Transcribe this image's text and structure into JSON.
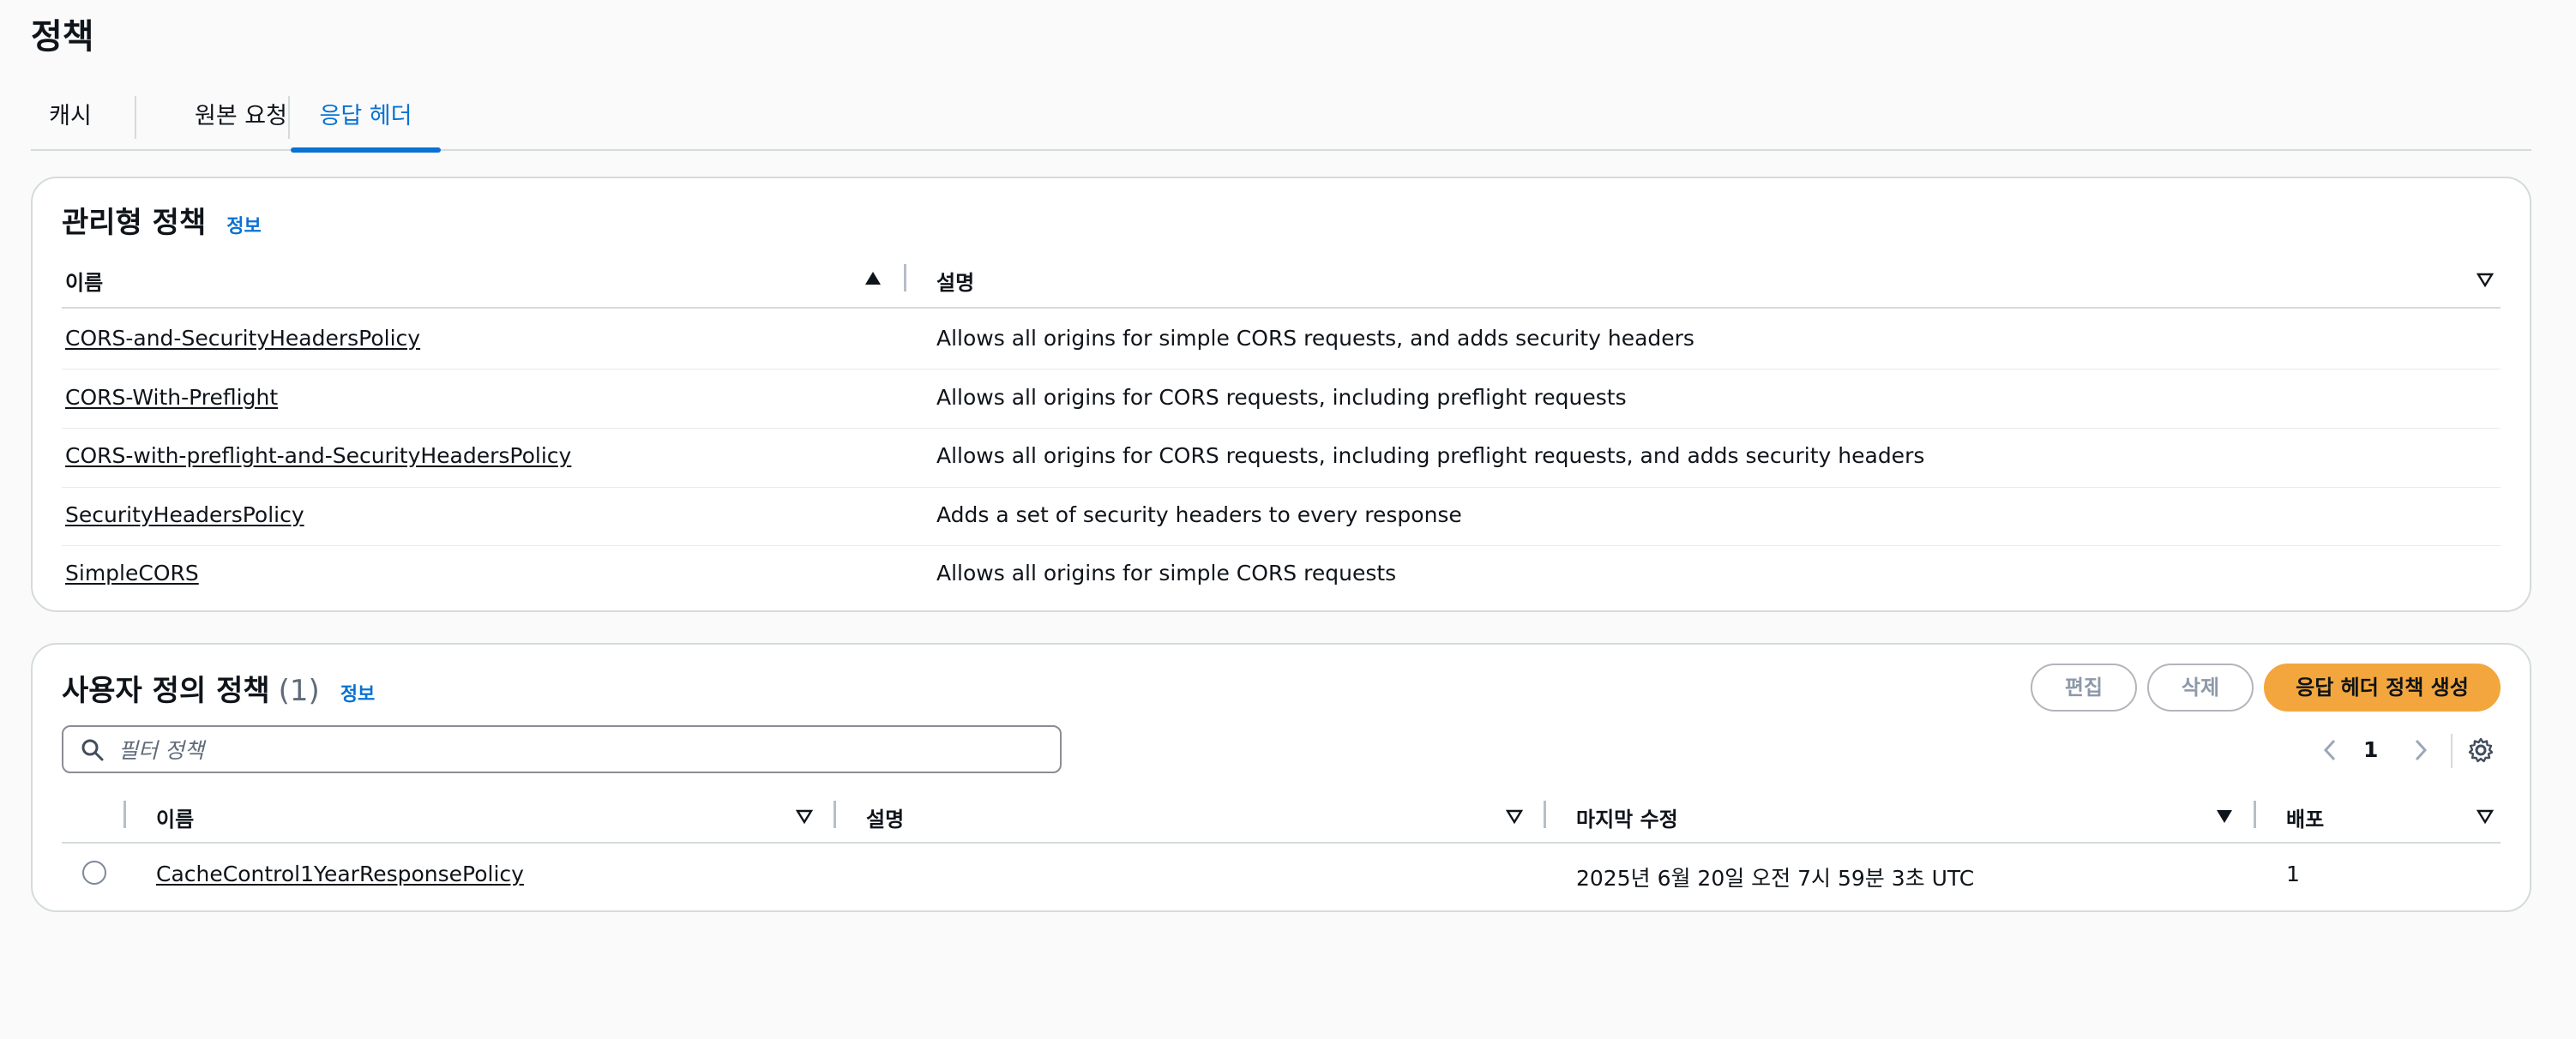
{
  "page": {
    "title": "정책"
  },
  "tabs": [
    {
      "label": "캐시"
    },
    {
      "label": "원본 요청"
    },
    {
      "label": "응답 헤더"
    }
  ],
  "managed": {
    "title": "관리형 정책",
    "info": "정보",
    "columns": {
      "name": "이름",
      "description": "설명"
    },
    "rows": [
      {
        "name": "CORS-and-SecurityHeadersPolicy",
        "description": "Allows all origins for simple CORS requests, and adds security headers"
      },
      {
        "name": "CORS-With-Preflight",
        "description": "Allows all origins for CORS requests, including preflight requests"
      },
      {
        "name": "CORS-with-preflight-and-SecurityHeadersPolicy",
        "description": "Allows all origins for CORS requests, including preflight requests, and adds security headers"
      },
      {
        "name": "SecurityHeadersPolicy",
        "description": "Adds a set of security headers to every response"
      },
      {
        "name": "SimpleCORS",
        "description": "Allows all origins for simple CORS requests"
      }
    ]
  },
  "custom": {
    "title": "사용자 정의 정책",
    "count": "(1)",
    "info": "정보",
    "buttons": {
      "edit": "편집",
      "delete": "삭제",
      "create": "응답 헤더 정책 생성"
    },
    "search": {
      "placeholder": "필터 정책"
    },
    "pagination": {
      "page": "1"
    },
    "columns": {
      "name": "이름",
      "description": "설명",
      "last_modified": "마지막 수정",
      "deployment": "배포"
    },
    "rows": [
      {
        "name": "CacheControl1YearResponsePolicy",
        "description": "",
        "last_modified": "2025년 6월 20일 오전 7시 59분 3초 UTC",
        "deployment": "1"
      }
    ]
  },
  "colors": {
    "accent": "#0972d3",
    "primary_button": "#f3a63d",
    "border": "#d5dbdb"
  }
}
